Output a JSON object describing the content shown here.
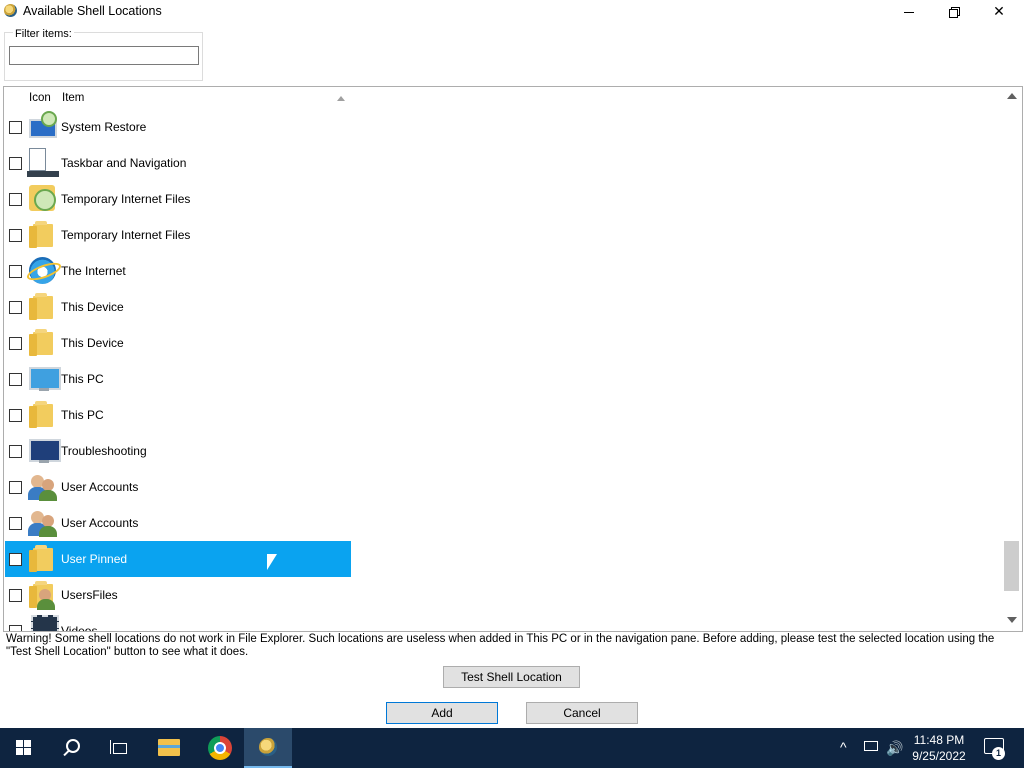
{
  "window": {
    "title": "Available Shell Locations",
    "minimize_glyph": "—",
    "close_glyph": "✕"
  },
  "filter": {
    "label": "Filter items:",
    "value": ""
  },
  "list": {
    "columns": {
      "icon": "Icon",
      "item": "Item"
    },
    "sort": "item-ascending",
    "rows": [
      {
        "label": "System Restore",
        "icon": "system-restore-icon",
        "checked": false,
        "selected": false
      },
      {
        "label": "Taskbar and Navigation",
        "icon": "taskbar-icon",
        "checked": false,
        "selected": false
      },
      {
        "label": "Temporary Internet Files",
        "icon": "clock-folder-icon",
        "checked": false,
        "selected": false
      },
      {
        "label": "Temporary Internet Files",
        "icon": "folder-icon",
        "checked": false,
        "selected": false
      },
      {
        "label": "The Internet",
        "icon": "internet-explorer-icon",
        "checked": false,
        "selected": false
      },
      {
        "label": "This Device",
        "icon": "folder-icon",
        "checked": false,
        "selected": false
      },
      {
        "label": "This Device",
        "icon": "folder-icon",
        "checked": false,
        "selected": false
      },
      {
        "label": "This PC",
        "icon": "computer-icon",
        "checked": false,
        "selected": false
      },
      {
        "label": "This PC",
        "icon": "folder-icon",
        "checked": false,
        "selected": false
      },
      {
        "label": "Troubleshooting",
        "icon": "troubleshooting-icon",
        "checked": false,
        "selected": false
      },
      {
        "label": "User Accounts",
        "icon": "user-accounts-icon",
        "checked": false,
        "selected": false
      },
      {
        "label": "User Accounts",
        "icon": "user-accounts-icon",
        "checked": false,
        "selected": false
      },
      {
        "label": "User Pinned",
        "icon": "folder-icon",
        "checked": false,
        "selected": true
      },
      {
        "label": "UsersFiles",
        "icon": "user-folder-icon",
        "checked": false,
        "selected": false
      },
      {
        "label": "Videos",
        "icon": "video-icon",
        "checked": false,
        "selected": false
      }
    ],
    "selection_color": "#0aa3f0"
  },
  "warning": "Warning! Some shell locations do not work in File Explorer. Such locations are useless when added in This PC or in the navigation pane. Before adding, please test the selected location using the \"Test Shell Location\" button to see what it does.",
  "buttons": {
    "test": "Test Shell Location",
    "add": "Add",
    "cancel": "Cancel"
  },
  "taskbar": {
    "time": "11:48 PM",
    "date": "9/25/2022",
    "notification_count": "1",
    "tray_chevron": "^",
    "volume_glyph": "🔊",
    "pinned": [
      "start-icon",
      "search-icon",
      "task-view-icon",
      "file-explorer-icon",
      "chrome-icon",
      "shell-locations-app-icon"
    ],
    "color": "#0e2440"
  }
}
